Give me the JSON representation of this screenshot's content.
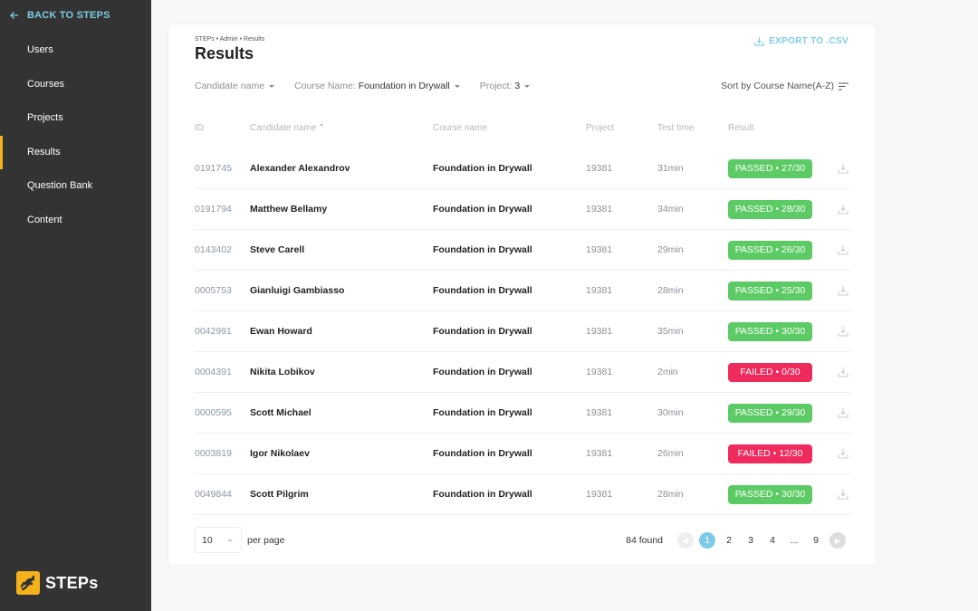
{
  "sidebar": {
    "back_label": "BACK TO STEPS",
    "items": [
      {
        "label": "Users",
        "active": false
      },
      {
        "label": "Courses",
        "active": false
      },
      {
        "label": "Projects",
        "active": false
      },
      {
        "label": "Results",
        "active": true
      },
      {
        "label": "Question Bank",
        "active": false
      },
      {
        "label": "Content",
        "active": false
      }
    ],
    "logo_text": "STEPs",
    "accent": "#f6b21b"
  },
  "header": {
    "breadcrumb": "STEPs • Admin • Results",
    "title": "Results",
    "export_label": "EXPORT TO .CSV"
  },
  "filters": {
    "candidate": {
      "label": "Candidate name"
    },
    "course": {
      "label": "Course Name:",
      "value": "Foundation in Drywall"
    },
    "project": {
      "label": "Project:",
      "value": "3"
    },
    "sort_label": "Sort by Course Name(A-Z)"
  },
  "table": {
    "columns": [
      "ID",
      "Candidate name",
      "Course name",
      "Project",
      "Test time",
      "Result"
    ],
    "rows": [
      {
        "id": "0191745",
        "name": "Alexander Alexandrov",
        "course": "Foundation in Drywall",
        "project": "19381",
        "time": "31min",
        "result": "PASSED • 27/30",
        "status": "pass"
      },
      {
        "id": "0191794",
        "name": "Matthew Bellamy",
        "course": "Foundation in Drywall",
        "project": "19381",
        "time": "34min",
        "result": "PASSED • 28/30",
        "status": "pass"
      },
      {
        "id": "0143402",
        "name": "Steve Carell",
        "course": "Foundation in Drywall",
        "project": "19381",
        "time": "29min",
        "result": "PASSED • 26/30",
        "status": "pass"
      },
      {
        "id": "0005753",
        "name": "Gianluigi Gambiasso",
        "course": "Foundation in Drywall",
        "project": "19381",
        "time": "28min",
        "result": "PASSED • 25/30",
        "status": "pass"
      },
      {
        "id": "0042991",
        "name": "Ewan Howard",
        "course": "Foundation in Drywall",
        "project": "19381",
        "time": "35min",
        "result": "PASSED • 30/30",
        "status": "pass"
      },
      {
        "id": "0004391",
        "name": "Nikita Lobikov",
        "course": "Foundation in Drywall",
        "project": "19381",
        "time": "2min",
        "result": "FAILED • 0/30",
        "status": "fail"
      },
      {
        "id": "0000595",
        "name": "Scott Michael",
        "course": "Foundation in Drywall",
        "project": "19381",
        "time": "30min",
        "result": "PASSED • 29/30",
        "status": "pass"
      },
      {
        "id": "0003819",
        "name": "Igor Nikolaev",
        "course": "Foundation in Drywall",
        "project": "19381",
        "time": "26min",
        "result": "FAILED • 12/30",
        "status": "fail"
      },
      {
        "id": "0049844",
        "name": "Scott Pilgrim",
        "course": "Foundation in Drywall",
        "project": "19381",
        "time": "28min",
        "result": "PASSED • 30/30",
        "status": "pass"
      }
    ]
  },
  "pagination": {
    "per_page": "10",
    "per_page_label": "per page",
    "found": "84 found",
    "pages": [
      "1",
      "2",
      "3",
      "4",
      "...",
      "9"
    ],
    "current": "1"
  },
  "colors": {
    "pass": "#5ccb65",
    "fail": "#ef2b5e",
    "link": "#7dcbe6"
  }
}
